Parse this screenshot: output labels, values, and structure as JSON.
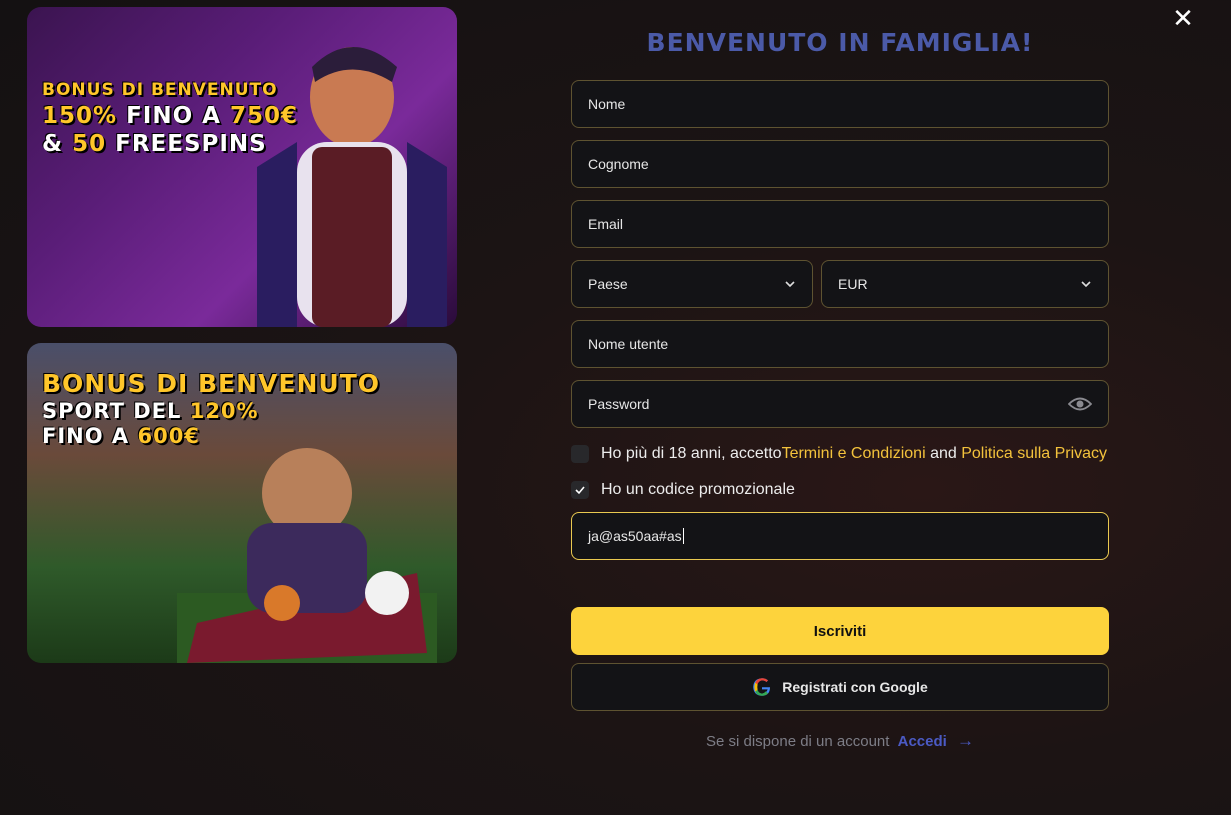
{
  "close_icon": "close-icon",
  "banners": {
    "casino": {
      "line1": "BONUS DI BENVENUTO",
      "line2a": "150%",
      "line2b": " FINO A ",
      "line2c": "750€",
      "line3a": "& ",
      "line3b": "50",
      "line3c": " FREESPINS"
    },
    "sport": {
      "line1": "BONUS DI BENVENUTO",
      "line2a": "SPORT DEL ",
      "line2b": "120%",
      "line3a": "FINO A ",
      "line3b": "600€"
    }
  },
  "form": {
    "title": "BENVENUTO IN FAMIGLIA!",
    "first_name_placeholder": "Nome",
    "last_name_placeholder": "Cognome",
    "email_placeholder": "Email",
    "country_label": "Paese",
    "currency_label": "EUR",
    "username_placeholder": "Nome utente",
    "password_placeholder": "Password",
    "terms": {
      "prefix": "Ho più di 18 anni, accetto ",
      "terms_link": "Termini e Condizioni",
      "and": " and ",
      "privacy_link": "Politica sulla Privacy",
      "checked": false
    },
    "promo": {
      "label": "Ho un codice promozionale",
      "checked": true,
      "value": "ja@as50aa#as"
    },
    "submit_label": "Iscriviti",
    "google_label": "Registrati con Google",
    "login_prompt": "Se si dispone di un account",
    "login_link": "Accedi",
    "login_arrow": "→"
  },
  "colors": {
    "accent_gold": "#fdd33c",
    "title_blue": "#4b5aa8",
    "link_blue": "#4b5ac4",
    "field_border": "#5e5331"
  }
}
